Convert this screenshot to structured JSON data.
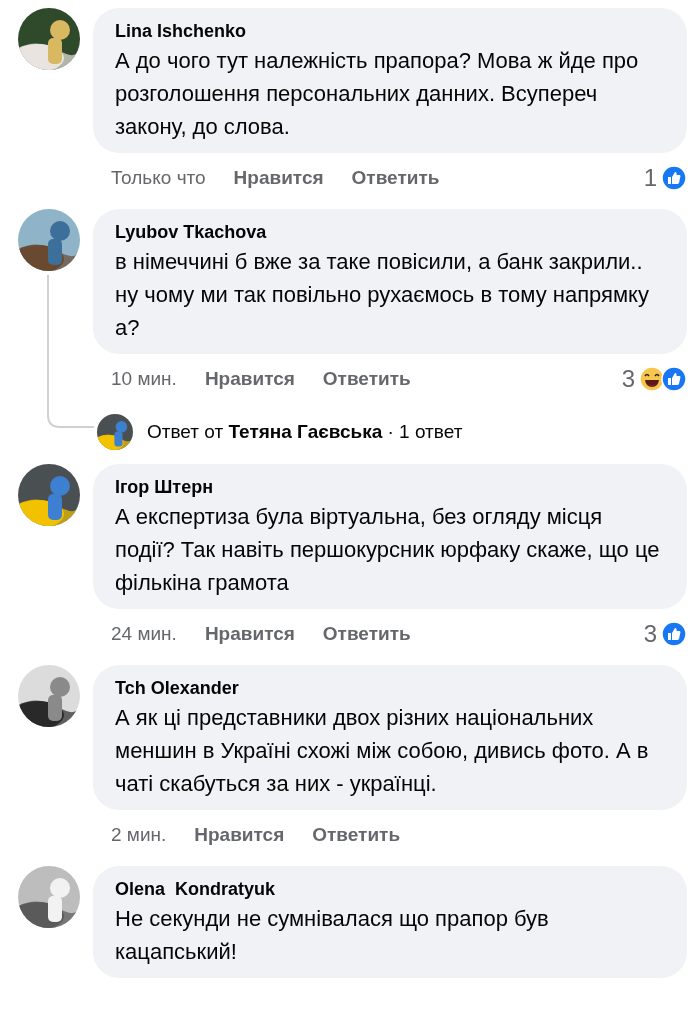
{
  "comments": [
    {
      "author": "Lina Ishchenko",
      "text": "А до чого тут належність прапора? Мова ж йде про розголошення персональних данних. Всупереч закону, до слова.",
      "time": "Только что",
      "like": "Нравится",
      "reply": "Ответить",
      "reaction_count": "1",
      "reactions": [
        {
          "kind": "like"
        }
      ]
    },
    {
      "author": "Lyubov Tkachova",
      "text": "в німеччині б вже за таке повісили, а банк закрили.. ну чому ми так повільно рухаємось в тому напрямку а?",
      "time": "10 мин.",
      "like": "Нравится",
      "reply": "Ответить",
      "reaction_count": "3",
      "reactions": [
        {
          "kind": "haha"
        },
        {
          "kind": "like"
        }
      ],
      "replies_link": "Ответ от **Тетяна Гаєвська** · 1 ответ"
    },
    {
      "author": "Ігор Штерн",
      "text": "А експертиза була віртуальна, без огляду місця події? Так навіть першокурсник юрфаку скаже, що це фількіна грамота",
      "time": "24 мин.",
      "like": "Нравится",
      "reply": "Ответить",
      "reaction_count": "3",
      "reactions": [
        {
          "kind": "like"
        }
      ]
    },
    {
      "author": "Tch Olexander",
      "text": "А як ці представники двох різних національних меншин в Україні схожі між собою, дивись фото. А в чаті скабуться за них - українці.",
      "time": "2 мин.",
      "like": "Нравится",
      "reply": "Ответить"
    },
    {
      "author": "Olena  Kondratyuk",
      "text": "Не секунди не сумнівалася що прапор був кацапський!"
    }
  ]
}
